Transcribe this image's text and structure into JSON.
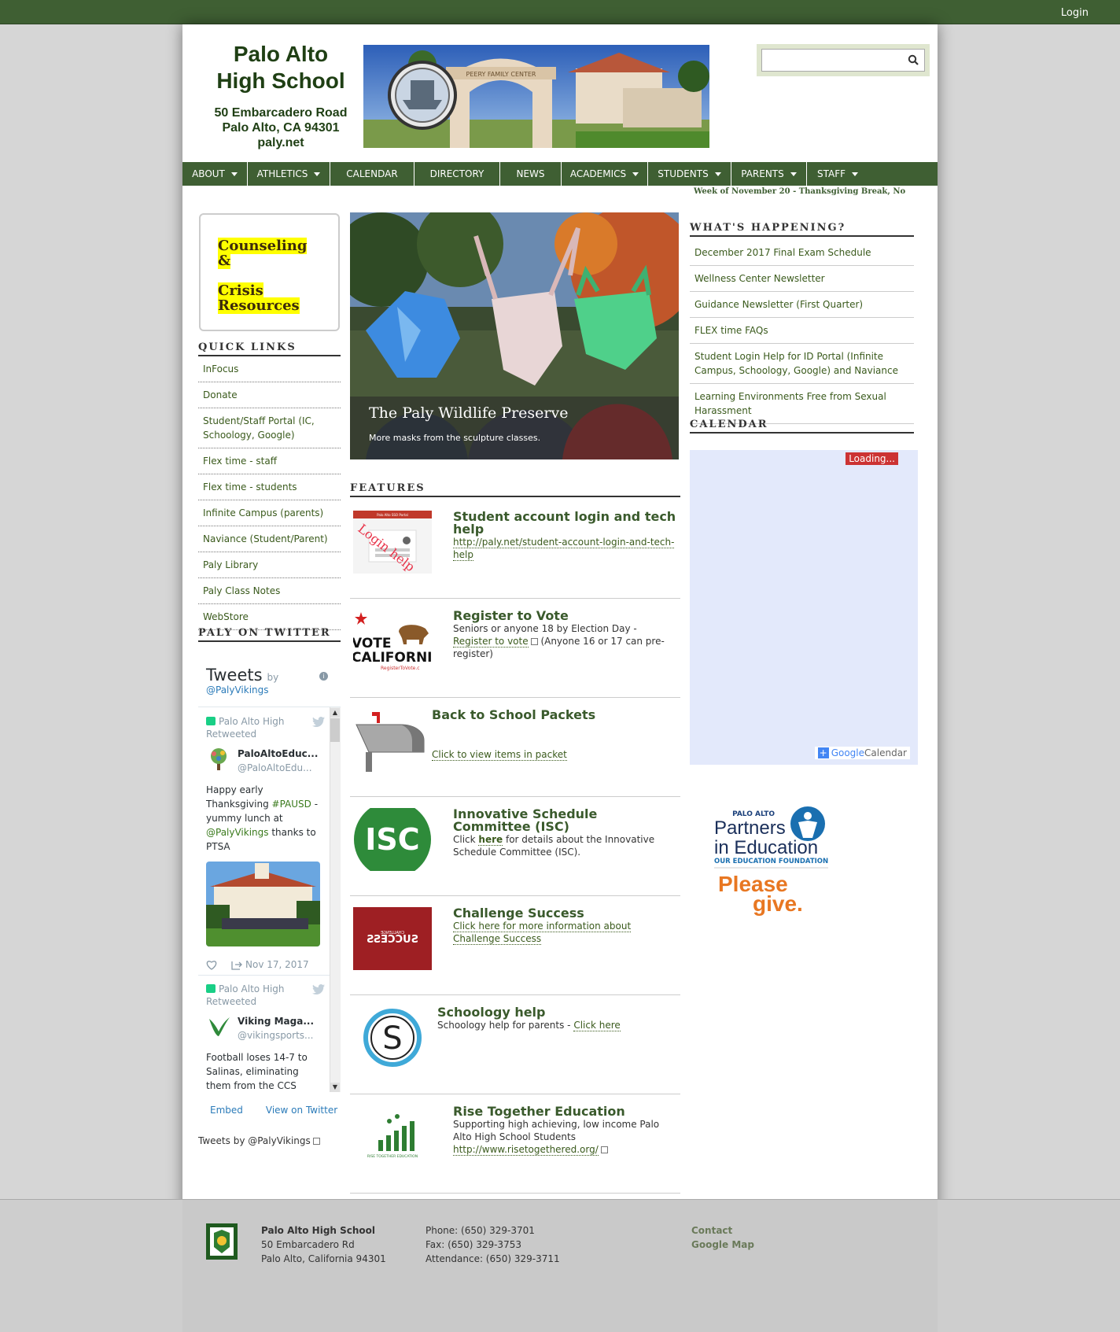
{
  "topbar": {
    "login": "Login"
  },
  "header": {
    "school_name_line1": "Palo Alto",
    "school_name_line2": "High School",
    "address_line1": "50 Embarcadero Road",
    "address_line2": "Palo Alto, CA 94301",
    "website": "paly.net",
    "banner_sign": "PEERY FAMILY CENTER",
    "search": {
      "value": "",
      "placeholder": ""
    }
  },
  "nav": [
    {
      "label": "ABOUT",
      "dropdown": true
    },
    {
      "label": "ATHLETICS",
      "dropdown": true
    },
    {
      "label": "CALENDAR",
      "dropdown": false
    },
    {
      "label": "DIRECTORY",
      "dropdown": false
    },
    {
      "label": "NEWS",
      "dropdown": false
    },
    {
      "label": "ACADEMICS",
      "dropdown": true
    },
    {
      "label": "STUDENTS",
      "dropdown": true
    },
    {
      "label": "PARENTS",
      "dropdown": true
    },
    {
      "label": "STAFF",
      "dropdown": true
    }
  ],
  "ticker": "Week of November 20 - Thanksgiving Break, No",
  "counseling": {
    "line1": "Counseling",
    "line2": "&",
    "line3": "Crisis",
    "line4": "Resources"
  },
  "quick_links": {
    "heading": "QUICK LINKS",
    "items": [
      "InFocus",
      "Donate",
      "Student/Staff Portal (IC, Schoology, Google)",
      "Flex time - staff",
      "Flex time - students",
      "Infinite Campus (parents)",
      "Naviance (Student/Parent)",
      "Paly Library",
      "Paly Class Notes",
      "WebStore"
    ]
  },
  "twitter": {
    "heading": "PALY ON TWITTER",
    "title": "Tweets",
    "by": "by",
    "handle": "@PalyVikings",
    "tweets": [
      {
        "retweeted_by": "Palo Alto High",
        "retweeted": "Retweeted",
        "name": "PaloAltoEduc...",
        "user": "@PaloAltoEdu...",
        "text_a": "Happy early Thanksgiving ",
        "hashtag": "#PAUSD",
        "text_b": " - yummy lunch at ",
        "mention": "@PalyVikings",
        "text_c": " thanks to PTSA",
        "date": "Nov 17, 2017"
      },
      {
        "retweeted_by": "Palo Alto High",
        "retweeted": "Retweeted",
        "name": "Viking Maga...",
        "user": "@vikingsports...",
        "text": "Football loses 14-7 to Salinas, eliminating them from the CCS"
      }
    ],
    "embed": "Embed",
    "view": "View on Twitter",
    "tweets_by": "Tweets by @PalyVikings"
  },
  "slideshow": {
    "title": "The Paly Wildlife Preserve",
    "subtitle": "More masks from the sculpture classes."
  },
  "features": {
    "heading": "FEATURES",
    "items": [
      {
        "title": "Student account login and tech help",
        "link": "http://paly.net/student-account-login-and-tech-help",
        "img_text": "Login help",
        "img_header": "Palo Alto SSO Portal"
      },
      {
        "title": "Register to Vote",
        "text_a": "Seniors or anyone 18 by Election Day - ",
        "link": "Register to vote",
        "text_b": " (Anyone 16 or 17 can pre-register)",
        "img_line1": "VOTE",
        "img_line2": "CALIFORNI",
        "img_line3": "RegisterToVote.c"
      },
      {
        "title": "Back to School Packets",
        "link": "Click to view items in packet"
      },
      {
        "title": "Innovative Schedule Committee (ISC)",
        "text_a": "Click ",
        "link": "here",
        "text_b": " for details about the Innovative Schedule Committee (ISC).",
        "img_text": "ISC"
      },
      {
        "title": "Challenge Success",
        "link": "Click here for more information about Challenge Success",
        "img_small": "CHALLENGE",
        "img_text": "SUCCESS"
      },
      {
        "title": "Schoology help",
        "text_a": "Schoology help for parents - ",
        "link": "Click here",
        "img_text": "S"
      },
      {
        "title": "Rise Together Education",
        "text": "Supporting high achieving, low income Palo Alto High School Students",
        "link": "http://www.risetogethered.org/",
        "img_text": "RISE TOGETHER EDUCATION"
      }
    ]
  },
  "whats_happening": {
    "heading": "WHAT'S HAPPENING?",
    "items": [
      "December 2017 Final Exam Schedule",
      "Wellness Center Newsletter",
      "Guidance Newsletter (First Quarter)",
      "FLEX time FAQs",
      "Student Login Help for ID Portal (Infinite Campus, Schoology, Google) and Naviance",
      "Learning Environments Free from Sexual Harassment"
    ]
  },
  "calendar": {
    "heading": "CALENDAR",
    "loading": "Loading...",
    "google": "Google",
    "cal_word": "Calendar",
    "plus": "+"
  },
  "pie_ad": {
    "small": "PALO ALTO",
    "line1": "Partners",
    "line2": "in Education",
    "line3": "OUR EDUCATION FOUNDATION",
    "please": "Please",
    "give": "give."
  },
  "footer": {
    "name": "Palo Alto High School",
    "addr1": "50 Embarcadero Rd",
    "addr2": "Palo Alto, California 94301",
    "phone": "Phone: (650) 329-3701",
    "fax": "Fax: (650) 329-3753",
    "attendance": "Attendance: (650) 329-3711",
    "contact": "Contact",
    "map": "Google Map"
  },
  "colors": {
    "brand_green": "#3f5f33",
    "link_green": "#3a5a1c",
    "highlight": "#ffff00"
  }
}
